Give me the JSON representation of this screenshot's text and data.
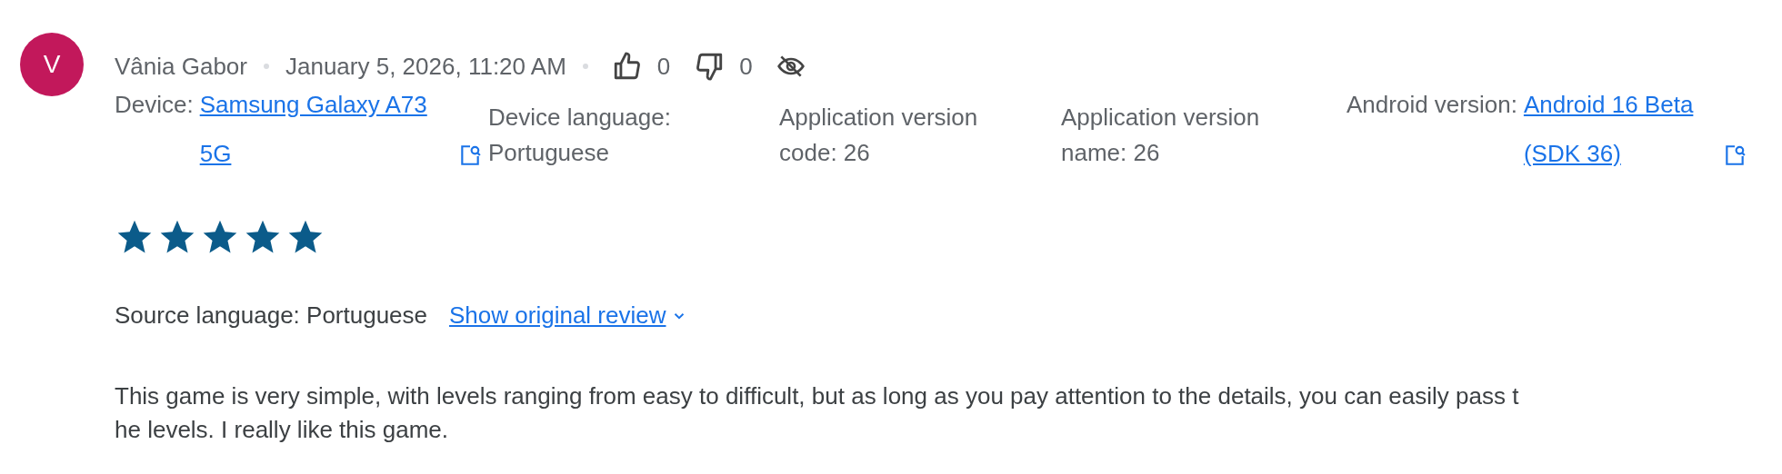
{
  "review": {
    "avatar_letter": "V",
    "author": "Vânia Gabor",
    "date": "January 5, 2026, 11:20 AM",
    "likes": "0",
    "dislikes": "0",
    "details": [
      {
        "kind": "link",
        "label": "Device:",
        "value": "Samsung Galaxy A73 5G"
      },
      {
        "kind": "text",
        "label": "Device language:",
        "value": "Portuguese"
      },
      {
        "kind": "text",
        "label": "Application version code:",
        "value": "26"
      },
      {
        "kind": "text",
        "label": "Application version name:",
        "value": "26"
      },
      {
        "kind": "link",
        "label": "Android version:",
        "value": "Android 16 Beta (SDK 36)"
      }
    ],
    "stars": 5,
    "source_language": "Source language: Portuguese",
    "show_original": "Show original review",
    "text": "This game is very simple, with levels ranging from easy to difficult, but as long as you pay attention to the details, you can easily pass the levels. I really like this game."
  }
}
